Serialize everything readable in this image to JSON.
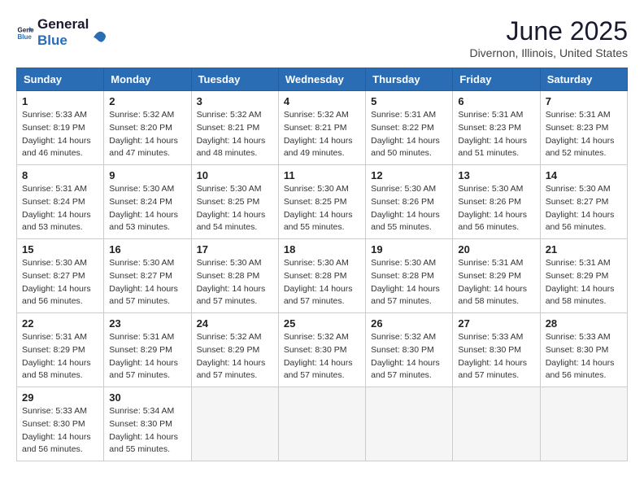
{
  "header": {
    "logo_general": "General",
    "logo_blue": "Blue",
    "month_title": "June 2025",
    "location": "Divernon, Illinois, United States"
  },
  "days_of_week": [
    "Sunday",
    "Monday",
    "Tuesday",
    "Wednesday",
    "Thursday",
    "Friday",
    "Saturday"
  ],
  "weeks": [
    [
      {
        "day": "1",
        "sunrise": "5:33 AM",
        "sunset": "8:19 PM",
        "daylight": "14 hours and 46 minutes."
      },
      {
        "day": "2",
        "sunrise": "5:32 AM",
        "sunset": "8:20 PM",
        "daylight": "14 hours and 47 minutes."
      },
      {
        "day": "3",
        "sunrise": "5:32 AM",
        "sunset": "8:21 PM",
        "daylight": "14 hours and 48 minutes."
      },
      {
        "day": "4",
        "sunrise": "5:32 AM",
        "sunset": "8:21 PM",
        "daylight": "14 hours and 49 minutes."
      },
      {
        "day": "5",
        "sunrise": "5:31 AM",
        "sunset": "8:22 PM",
        "daylight": "14 hours and 50 minutes."
      },
      {
        "day": "6",
        "sunrise": "5:31 AM",
        "sunset": "8:23 PM",
        "daylight": "14 hours and 51 minutes."
      },
      {
        "day": "7",
        "sunrise": "5:31 AM",
        "sunset": "8:23 PM",
        "daylight": "14 hours and 52 minutes."
      }
    ],
    [
      {
        "day": "8",
        "sunrise": "5:31 AM",
        "sunset": "8:24 PM",
        "daylight": "14 hours and 53 minutes."
      },
      {
        "day": "9",
        "sunrise": "5:30 AM",
        "sunset": "8:24 PM",
        "daylight": "14 hours and 53 minutes."
      },
      {
        "day": "10",
        "sunrise": "5:30 AM",
        "sunset": "8:25 PM",
        "daylight": "14 hours and 54 minutes."
      },
      {
        "day": "11",
        "sunrise": "5:30 AM",
        "sunset": "8:25 PM",
        "daylight": "14 hours and 55 minutes."
      },
      {
        "day": "12",
        "sunrise": "5:30 AM",
        "sunset": "8:26 PM",
        "daylight": "14 hours and 55 minutes."
      },
      {
        "day": "13",
        "sunrise": "5:30 AM",
        "sunset": "8:26 PM",
        "daylight": "14 hours and 56 minutes."
      },
      {
        "day": "14",
        "sunrise": "5:30 AM",
        "sunset": "8:27 PM",
        "daylight": "14 hours and 56 minutes."
      }
    ],
    [
      {
        "day": "15",
        "sunrise": "5:30 AM",
        "sunset": "8:27 PM",
        "daylight": "14 hours and 56 minutes."
      },
      {
        "day": "16",
        "sunrise": "5:30 AM",
        "sunset": "8:27 PM",
        "daylight": "14 hours and 57 minutes."
      },
      {
        "day": "17",
        "sunrise": "5:30 AM",
        "sunset": "8:28 PM",
        "daylight": "14 hours and 57 minutes."
      },
      {
        "day": "18",
        "sunrise": "5:30 AM",
        "sunset": "8:28 PM",
        "daylight": "14 hours and 57 minutes."
      },
      {
        "day": "19",
        "sunrise": "5:30 AM",
        "sunset": "8:28 PM",
        "daylight": "14 hours and 57 minutes."
      },
      {
        "day": "20",
        "sunrise": "5:31 AM",
        "sunset": "8:29 PM",
        "daylight": "14 hours and 58 minutes."
      },
      {
        "day": "21",
        "sunrise": "5:31 AM",
        "sunset": "8:29 PM",
        "daylight": "14 hours and 58 minutes."
      }
    ],
    [
      {
        "day": "22",
        "sunrise": "5:31 AM",
        "sunset": "8:29 PM",
        "daylight": "14 hours and 58 minutes."
      },
      {
        "day": "23",
        "sunrise": "5:31 AM",
        "sunset": "8:29 PM",
        "daylight": "14 hours and 57 minutes."
      },
      {
        "day": "24",
        "sunrise": "5:32 AM",
        "sunset": "8:29 PM",
        "daylight": "14 hours and 57 minutes."
      },
      {
        "day": "25",
        "sunrise": "5:32 AM",
        "sunset": "8:30 PM",
        "daylight": "14 hours and 57 minutes."
      },
      {
        "day": "26",
        "sunrise": "5:32 AM",
        "sunset": "8:30 PM",
        "daylight": "14 hours and 57 minutes."
      },
      {
        "day": "27",
        "sunrise": "5:33 AM",
        "sunset": "8:30 PM",
        "daylight": "14 hours and 57 minutes."
      },
      {
        "day": "28",
        "sunrise": "5:33 AM",
        "sunset": "8:30 PM",
        "daylight": "14 hours and 56 minutes."
      }
    ],
    [
      {
        "day": "29",
        "sunrise": "5:33 AM",
        "sunset": "8:30 PM",
        "daylight": "14 hours and 56 minutes."
      },
      {
        "day": "30",
        "sunrise": "5:34 AM",
        "sunset": "8:30 PM",
        "daylight": "14 hours and 55 minutes."
      },
      null,
      null,
      null,
      null,
      null
    ]
  ]
}
